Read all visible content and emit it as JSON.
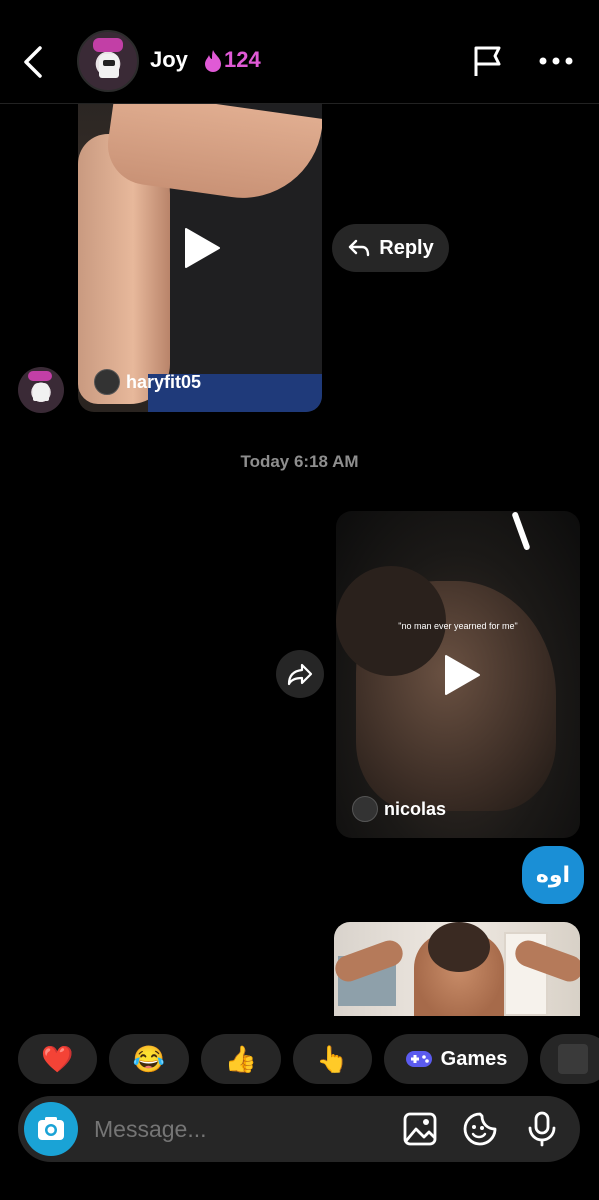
{
  "header": {
    "contact_name": "Joy",
    "streak_count": "124",
    "streak_color": "#e05ad6",
    "icons": [
      "chevron-left-icon",
      "flame-icon",
      "flag-icon",
      "more-horizontal-icon"
    ]
  },
  "messages": {
    "video1": {
      "credit": "haryfit05"
    },
    "reply_label": "Reply",
    "timestamp": "Today 6:18 AM",
    "video2": {
      "caption": "\"no man ever yearned for me\"",
      "credit": "nicolas"
    },
    "text_bubble": "اوه",
    "bubble_color": "#1a8fd6"
  },
  "reactions": {
    "items": [
      {
        "emoji": "❤️",
        "icon": "heart-icon"
      },
      {
        "emoji": "😂",
        "icon": "laughing-icon"
      },
      {
        "emoji": "👍",
        "icon": "thumbs-up-icon"
      },
      {
        "emoji": "👆",
        "icon": "pointing-up-icon"
      }
    ],
    "games_label": "Games"
  },
  "composer": {
    "placeholder": "Message...",
    "icons": [
      "camera-icon",
      "gallery-icon",
      "sticker-icon",
      "microphone-icon"
    ],
    "accent": "#1aa3d6"
  }
}
